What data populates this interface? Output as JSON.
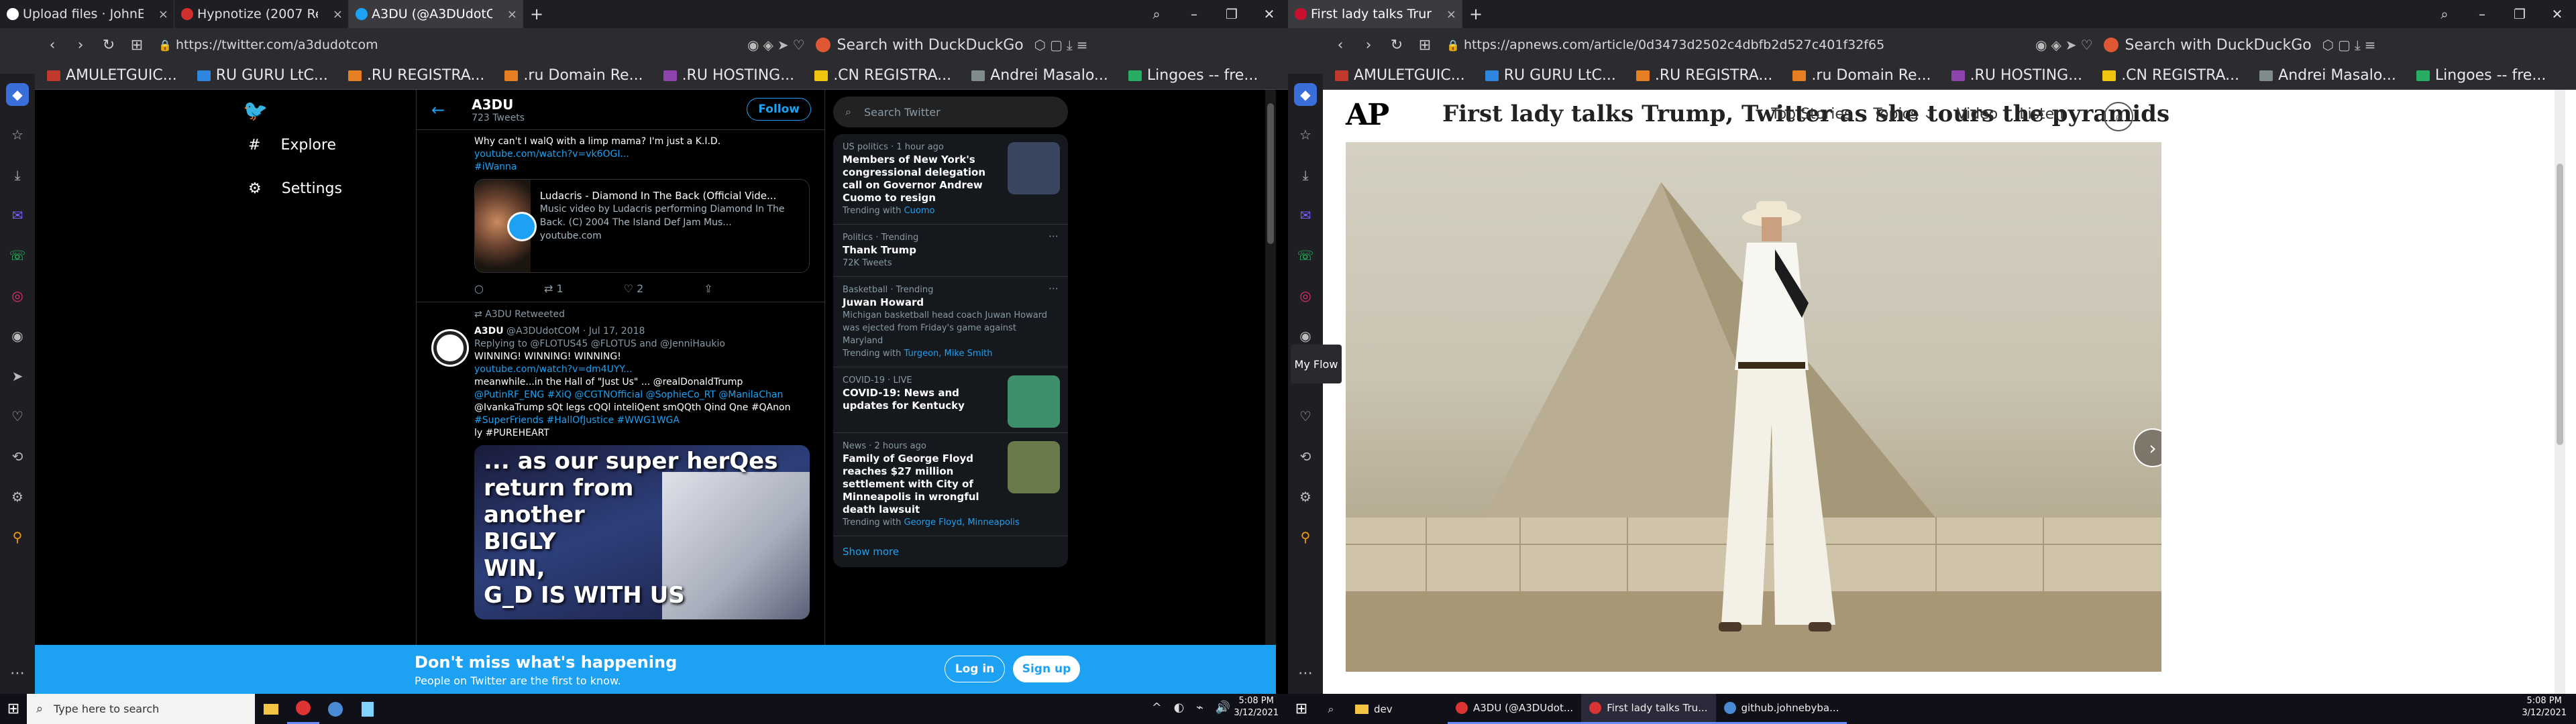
{
  "left": {
    "tabs": [
      {
        "label": "Upload files · JohnE",
        "icon": "github-icon",
        "color": "#ffffff"
      },
      {
        "label": "Hypnotize (2007 Re",
        "icon": "page-icon",
        "color": "#d32f2f"
      },
      {
        "label": "A3DU (@A3DUdotC",
        "icon": "twitter-icon",
        "color": "#1da1f2"
      }
    ],
    "url": "https://twitter.com/a3dudotcom",
    "search_placeholder": "Search with DuckDuckGo",
    "bookmarks": [
      "AMULETGUIC...",
      "RU GURU LtC...",
      ".RU REGISTRA...",
      ".ru Domain Re...",
      ".RU HOSTING...",
      ".CN REGISTRA...",
      "Andrei Masalo...",
      "Lingoes -- fre..."
    ],
    "twitter": {
      "nav": {
        "explore": "Explore",
        "settings": "Settings"
      },
      "header": {
        "name": "A3DU",
        "count": "723 Tweets",
        "follow": "Follow"
      },
      "tweet1": {
        "text": "Why can't I walQ with a limp mama? I'm just a K.I.D.",
        "link": "youtube.com/watch?v=vk6OGI...",
        "tag": "#iWanna",
        "card_title": "Ludacris - Diamond In The Back (Official Vide...",
        "card_desc": "Music video by Ludacris performing Diamond In The Back. (C) 2004 The Island Def Jam Mus...",
        "card_site": "youtube.com",
        "retweets": "1",
        "likes": "2"
      },
      "retweeted_by": "A3DU Retweeted",
      "tweet2": {
        "author": "A3DU",
        "handle": "@A3DUdotCOM · Jul 17, 2018",
        "replying": "Replying to @FLOTUS45 @FLOTUS and @JenniHaukio",
        "line1": "WINNING! WINNING! WINNING!",
        "line2": "youtube.com/watch?v=dm4UYY...",
        "line3": "meanwhile...in the Hall of \"Just Us\" ... @realDonaldTrump",
        "line4": "@PutinRF_ENG #XiQ @CGTNOfficial @SophieCo_RT @ManilaChan",
        "line5": "@IvankaTrump sQt legs cQQl inteliQent smQQth Qind Qne #QAnon",
        "line6": "#SuperFriends #HallOfJustice #WWG1WGA",
        "line7": "ly #PUREHEART",
        "meme_lines": [
          "... as our super herQes",
          "return from",
          "another",
          "BIGLY",
          "WIN,",
          "G_D IS WITH US"
        ]
      },
      "search_placeholder": "Search Twitter",
      "trends": [
        {
          "cat": "US politics · 1 hour ago",
          "title": "Members of New York's congressional delegation call on Governor Andrew Cuomo to resign",
          "sub": "Trending with",
          "with": "Cuomo",
          "img": "#3a4660"
        },
        {
          "cat": "Politics · Trending",
          "title": "Thank Trump",
          "sub": "72K Tweets",
          "with": ""
        },
        {
          "cat": "Basketball · Trending",
          "title": "Juwan Howard",
          "sub": "Michigan basketball head coach Juwan Howard was ejected from Friday's game against Maryland",
          "with": "Turgeon, Mike Smith"
        },
        {
          "cat": "COVID-19 · LIVE",
          "title": "COVID-19: News and updates for Kentucky",
          "sub": "",
          "with": "",
          "img": "#3e8f6b"
        },
        {
          "cat": "News · 2 hours ago",
          "title": "Family of George Floyd reaches $27 million settlement with City of Minneapolis in wrongful death lawsuit",
          "sub": "Trending with",
          "with": "George Floyd, Minneapolis",
          "img": "#6b7a4a"
        }
      ],
      "show_more": "Show more",
      "banner": {
        "title": "Don't miss what's happening",
        "sub": "People on Twitter are the first to know.",
        "login": "Log in",
        "signup": "Sign up"
      }
    },
    "taskbar": {
      "search": "Type here to search",
      "time": "5:08 PM",
      "date": "3/12/2021"
    }
  },
  "right": {
    "tabs": [
      {
        "label": "First lady talks Trum",
        "icon": "ap-icon",
        "color": "#c8102e"
      }
    ],
    "url": "https://apnews.com/article/0d3473d2502c4dbfb2d527c401f32f65",
    "search_placeholder": "Search with DuckDuckGo",
    "bookmarks": [
      "AMULETGUIC...",
      "RU GURU LtC...",
      ".RU REGISTRA...",
      ".ru Domain Re...",
      ".RU HOSTING...",
      ".CN REGISTRA...",
      "Andrei Masalo...",
      "Lingoes -- fre..."
    ],
    "ap": {
      "logo": "AP",
      "title": "First lady talks Trump, Twitter as she tours the pyramids",
      "nav": [
        "Top Stories",
        "Topics",
        "Video",
        "Listen"
      ],
      "myflow": "My Flow"
    },
    "taskbar": {
      "tasks": [
        "dev",
        "A3DU (@A3DUdot...",
        "First lady talks Tru...",
        "github.johnebyba..."
      ],
      "time": "5:08 PM",
      "date": "3/12/2021"
    }
  }
}
